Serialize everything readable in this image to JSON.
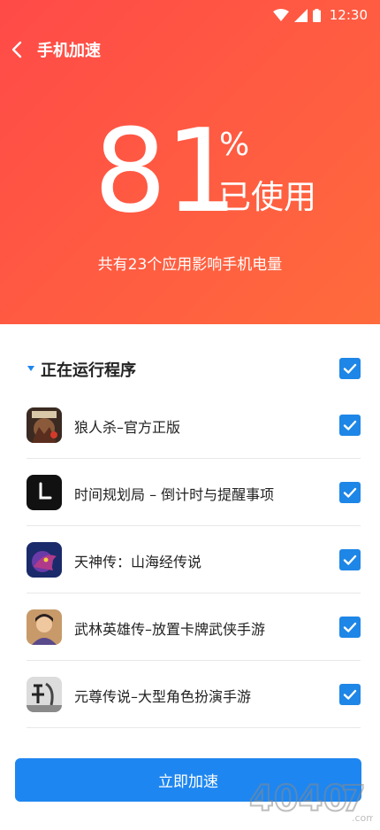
{
  "status_bar": {
    "time": "12:30",
    "icons": [
      "wifi-icon",
      "signal-icon",
      "battery-icon"
    ]
  },
  "nav": {
    "back_icon": "back-arrow-icon",
    "title": "手机加速"
  },
  "usage": {
    "value": "81",
    "unit": "%",
    "label": "已使用",
    "subtitle": "共有23个应用影响手机电量"
  },
  "section": {
    "title": "正在运行程序",
    "all_checked": true
  },
  "apps": [
    {
      "name": "狼人杀–官方正版",
      "icon": "werewolf-game-icon",
      "checked": true
    },
    {
      "name": "时间规划局 – 倒计时与提醒事项",
      "icon": "clock-app-icon",
      "checked": true
    },
    {
      "name": "天神传：山海经传说",
      "icon": "dragon-game-icon",
      "checked": true
    },
    {
      "name": "武林英雄传–放置卡牌武侠手游",
      "icon": "martial-hero-icon",
      "checked": true
    },
    {
      "name": "元尊传说–大型角色扮演手游",
      "icon": "yuanzun-game-icon",
      "checked": true
    }
  ],
  "action_button": {
    "label": "立即加速"
  },
  "watermark": {
    "text": "4.0.4.0.7.com"
  },
  "colors": {
    "hero_start": "#ff4a48",
    "hero_end": "#ff6b3c",
    "accent": "#1e86f0",
    "checkbox": "#1e86e6"
  }
}
